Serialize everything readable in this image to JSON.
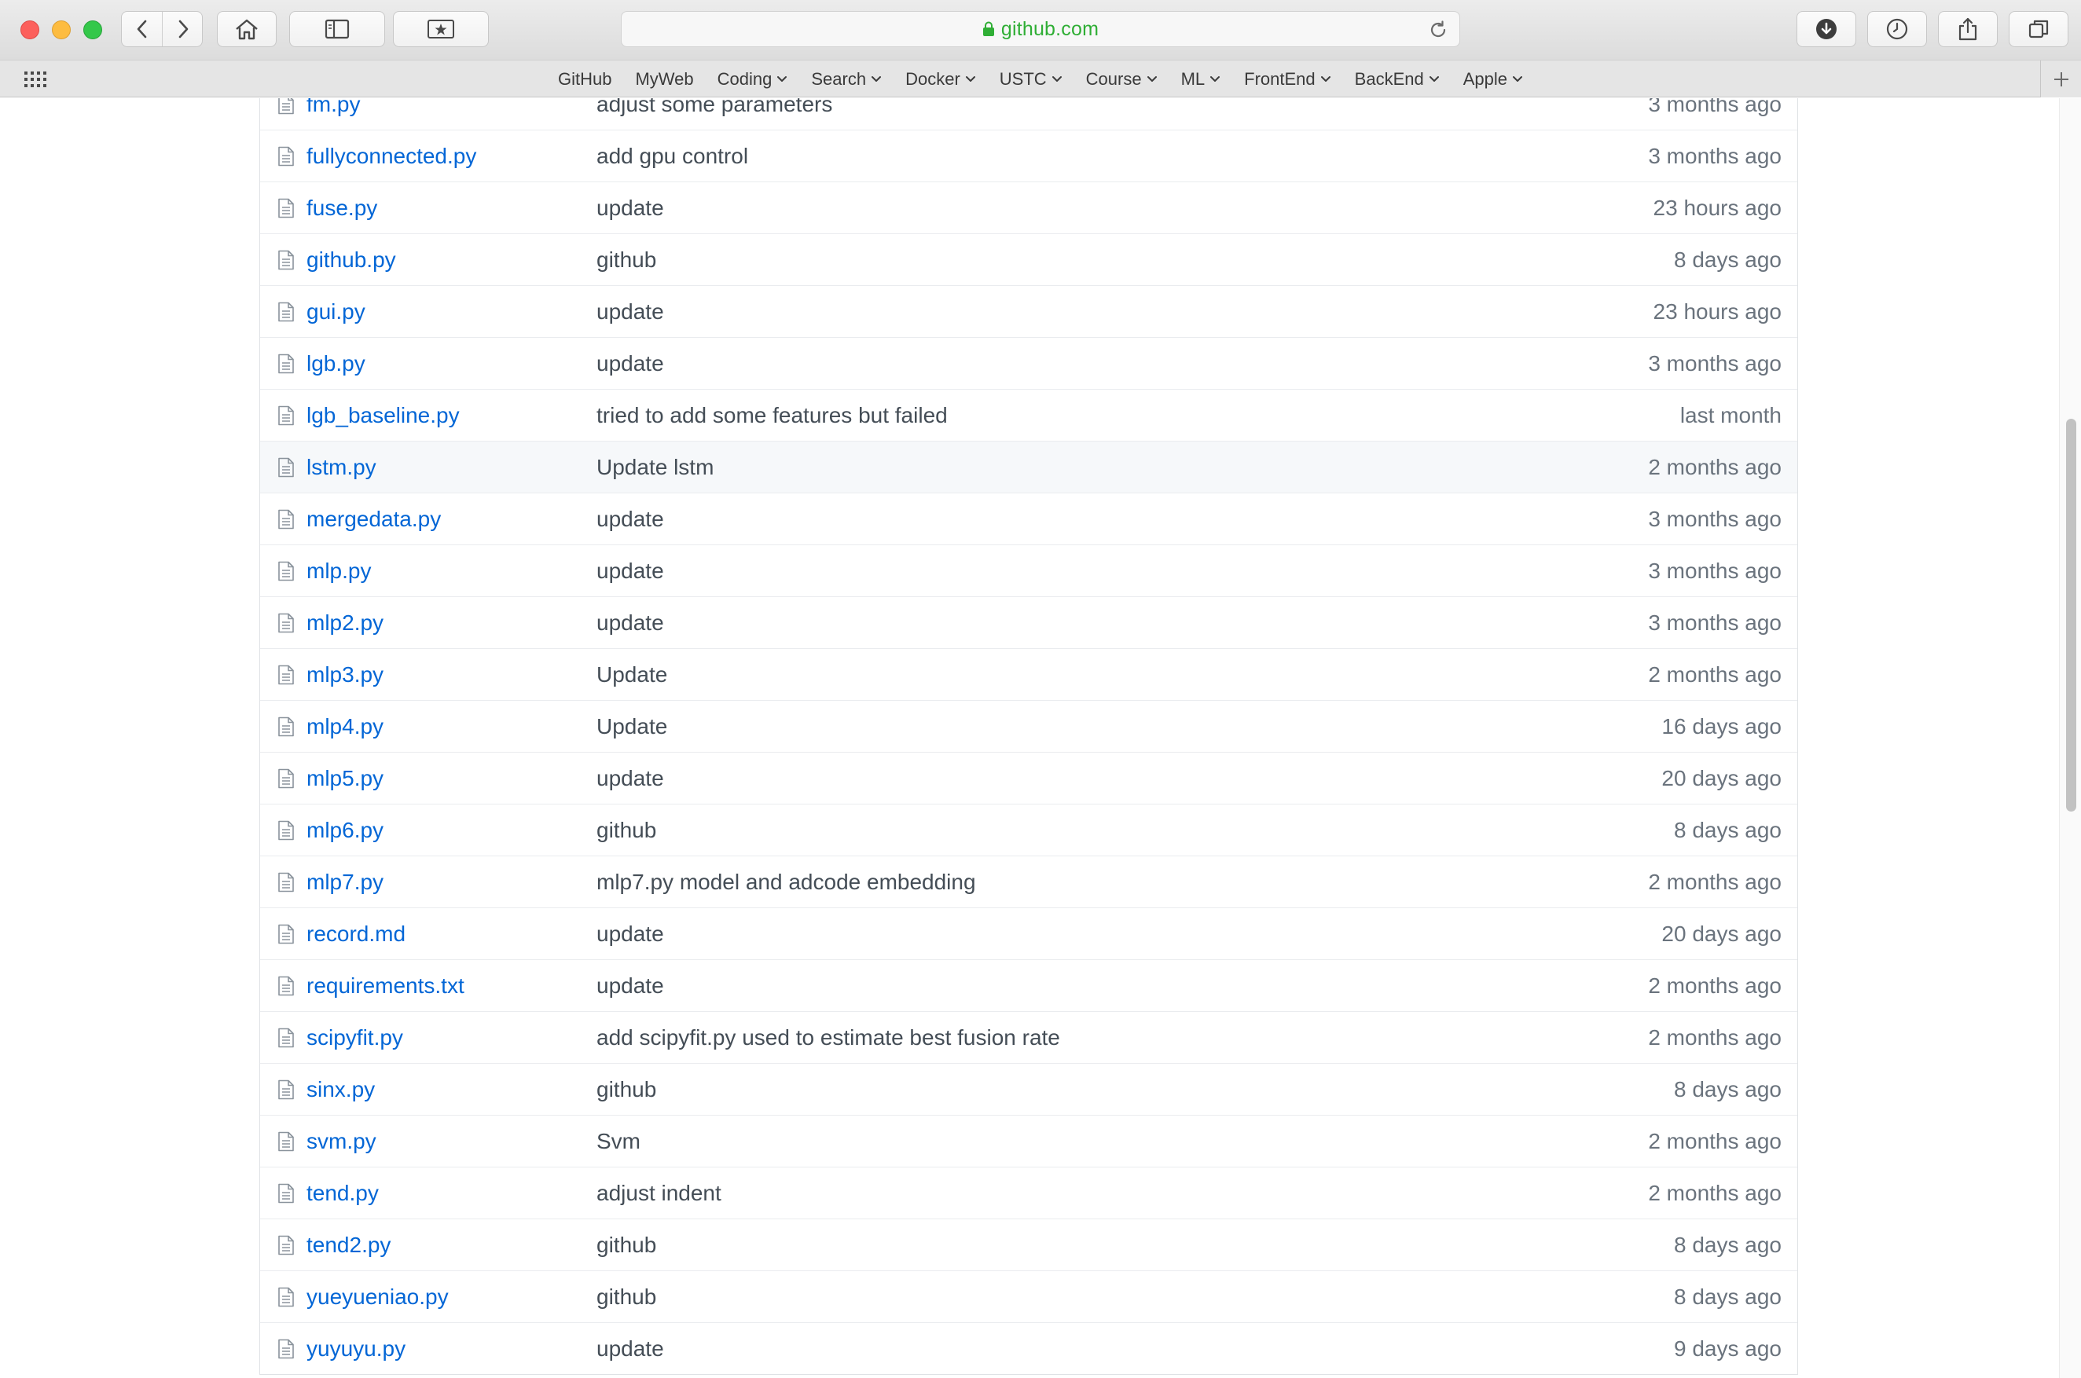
{
  "browser": {
    "url": "github.com",
    "bookmarks": [
      {
        "label": "GitHub",
        "dropdown": false
      },
      {
        "label": "MyWeb",
        "dropdown": false
      },
      {
        "label": "Coding",
        "dropdown": true
      },
      {
        "label": "Search",
        "dropdown": true
      },
      {
        "label": "Docker",
        "dropdown": true
      },
      {
        "label": "USTC",
        "dropdown": true
      },
      {
        "label": "Course",
        "dropdown": true
      },
      {
        "label": "ML",
        "dropdown": true
      },
      {
        "label": "FrontEnd",
        "dropdown": true
      },
      {
        "label": "BackEnd",
        "dropdown": true
      },
      {
        "label": "Apple",
        "dropdown": true
      }
    ],
    "accent_url_color": "#2fae35"
  },
  "files": [
    {
      "name": "fm.py",
      "message": "adjust some parameters",
      "age": "3 months ago"
    },
    {
      "name": "fullyconnected.py",
      "message": "add gpu control",
      "age": "3 months ago"
    },
    {
      "name": "fuse.py",
      "message": "update",
      "age": "23 hours ago"
    },
    {
      "name": "github.py",
      "message": "github",
      "age": "8 days ago"
    },
    {
      "name": "gui.py",
      "message": "update",
      "age": "23 hours ago"
    },
    {
      "name": "lgb.py",
      "message": "update",
      "age": "3 months ago"
    },
    {
      "name": "lgb_baseline.py",
      "message": "tried to add some features but failed",
      "age": "last month"
    },
    {
      "name": "lstm.py",
      "message": "Update lstm",
      "age": "2 months ago",
      "hover": true
    },
    {
      "name": "mergedata.py",
      "message": "update",
      "age": "3 months ago"
    },
    {
      "name": "mlp.py",
      "message": "update",
      "age": "3 months ago"
    },
    {
      "name": "mlp2.py",
      "message": "update",
      "age": "3 months ago"
    },
    {
      "name": "mlp3.py",
      "message": "Update",
      "age": "2 months ago"
    },
    {
      "name": "mlp4.py",
      "message": "Update",
      "age": "16 days ago"
    },
    {
      "name": "mlp5.py",
      "message": "update",
      "age": "20 days ago"
    },
    {
      "name": "mlp6.py",
      "message": "github",
      "age": "8 days ago"
    },
    {
      "name": "mlp7.py",
      "message": "mlp7.py model and adcode embedding",
      "age": "2 months ago"
    },
    {
      "name": "record.md",
      "message": "update",
      "age": "20 days ago"
    },
    {
      "name": "requirements.txt",
      "message": "update",
      "age": "2 months ago"
    },
    {
      "name": "scipyfit.py",
      "message": "add scipyfit.py used to estimate best fusion rate",
      "age": "2 months ago"
    },
    {
      "name": "sinx.py",
      "message": "github",
      "age": "8 days ago"
    },
    {
      "name": "svm.py",
      "message": "Svm",
      "age": "2 months ago"
    },
    {
      "name": "tend.py",
      "message": "adjust indent",
      "age": "2 months ago"
    },
    {
      "name": "tend2.py",
      "message": "github",
      "age": "8 days ago"
    },
    {
      "name": "yueyueniao.py",
      "message": "github",
      "age": "8 days ago"
    },
    {
      "name": "yuyuyu.py",
      "message": "update",
      "age": "9 days ago"
    }
  ]
}
